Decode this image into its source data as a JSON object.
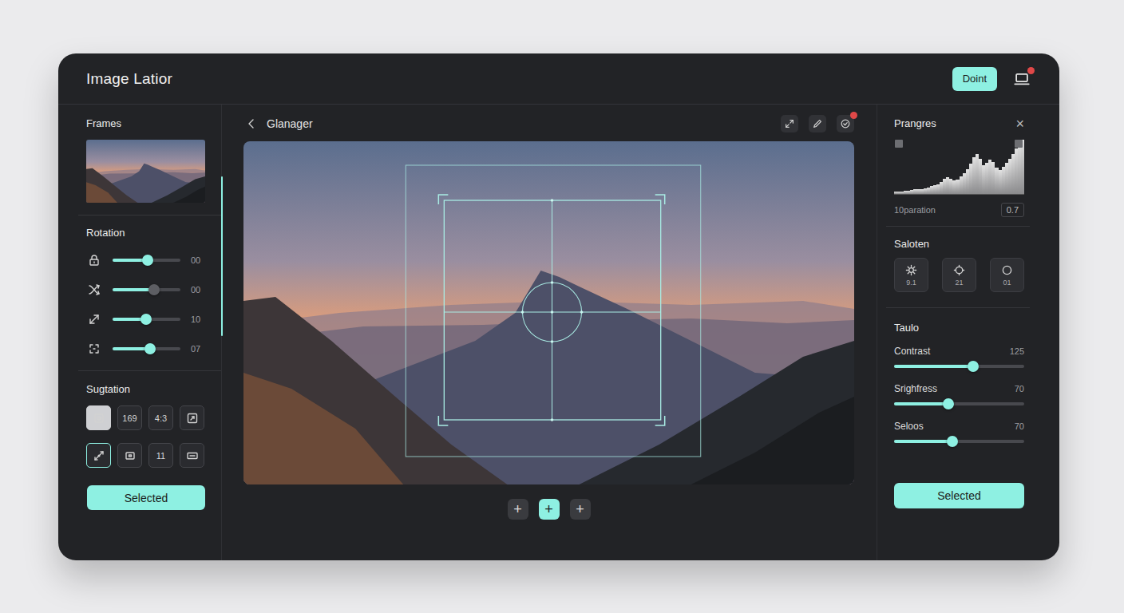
{
  "window": {
    "title": "Image Latior",
    "action": "Doint",
    "notification": true
  },
  "frames": {
    "title": "Frames"
  },
  "rotation": {
    "title": "Rotation",
    "sliders": [
      {
        "value": "00",
        "level": 0.52,
        "active": true
      },
      {
        "value": "00",
        "level": 0.61,
        "active": false
      },
      {
        "value": "10",
        "level": 0.49,
        "active": true
      },
      {
        "value": "07",
        "level": 0.55,
        "active": true
      }
    ]
  },
  "suggestion": {
    "title": "Sugtation",
    "rows": [
      [
        {
          "kind": "icon",
          "selected": true
        },
        {
          "kind": "text",
          "label": "169",
          "selected": false
        },
        {
          "kind": "text",
          "label": "4:3",
          "selected": false
        },
        {
          "kind": "icon",
          "selected": false
        }
      ],
      [
        {
          "kind": "icon",
          "selected": true
        },
        {
          "kind": "icon",
          "selected": false
        },
        {
          "kind": "text",
          "label": "11",
          "selected": false
        },
        {
          "kind": "icon",
          "selected": false
        }
      ]
    ],
    "button": "Selected"
  },
  "canvas": {
    "title": "Glanager",
    "tools": [
      {
        "badge": false
      },
      {
        "badge": false
      },
      {
        "badge": true
      }
    ],
    "zoom": [
      {
        "label": "+",
        "selected": false
      },
      {
        "label": "+",
        "selected": true
      },
      {
        "label": "+",
        "selected": false
      }
    ]
  },
  "adjust": {
    "title": "Prangres",
    "close": "×",
    "histogram": {
      "values": [
        4,
        5,
        5,
        6,
        6,
        7,
        8,
        8,
        9,
        10,
        12,
        14,
        16,
        18,
        22,
        28,
        30,
        27,
        24,
        26,
        32,
        38,
        45,
        55,
        66,
        72,
        64,
        52,
        56,
        62,
        58,
        48,
        44,
        50,
        57,
        64,
        72,
        82,
        92,
        98
      ]
    },
    "histogram_label": "10paration",
    "histogram_value": "0.7"
  },
  "presets": {
    "title": "Saloten",
    "items": [
      {
        "value": "9.1"
      },
      {
        "value": "21"
      },
      {
        "value": "01"
      }
    ]
  },
  "tone": {
    "title": "Taulo",
    "sliders": [
      {
        "label": "Contrast",
        "value": "125",
        "level": 0.61
      },
      {
        "label": "Srighfress",
        "value": "70",
        "level": 0.42
      },
      {
        "label": "Seloos",
        "value": "70",
        "level": 0.45
      }
    ],
    "button": "Selected"
  }
}
